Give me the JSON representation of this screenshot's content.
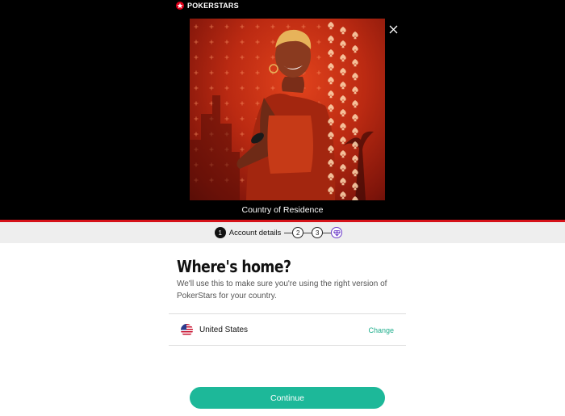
{
  "header": {
    "brand": "POKERSTARS",
    "close_icon": "close-icon"
  },
  "promo": {
    "caption": "Country of Residence"
  },
  "stepper": {
    "steps": [
      {
        "number": "1",
        "label": "Account details",
        "state": "active"
      },
      {
        "number": "2",
        "label": "",
        "state": "pending"
      },
      {
        "number": "3",
        "label": "",
        "state": "pending"
      },
      {
        "icon": "gem-icon",
        "state": "pending"
      }
    ]
  },
  "form": {
    "title": "Where's home?",
    "description": "We'll use this to make sure you're using the right version of PokerStars for your country.",
    "country": {
      "name": "United States",
      "flag_icon": "us-flag-icon",
      "change_label": "Change"
    },
    "continue_label": "Continue"
  },
  "colors": {
    "accent": "#1db899",
    "brand_red": "#d51219",
    "stepper_bg": "#eeeeee",
    "gem_purple": "#6a39c8"
  }
}
